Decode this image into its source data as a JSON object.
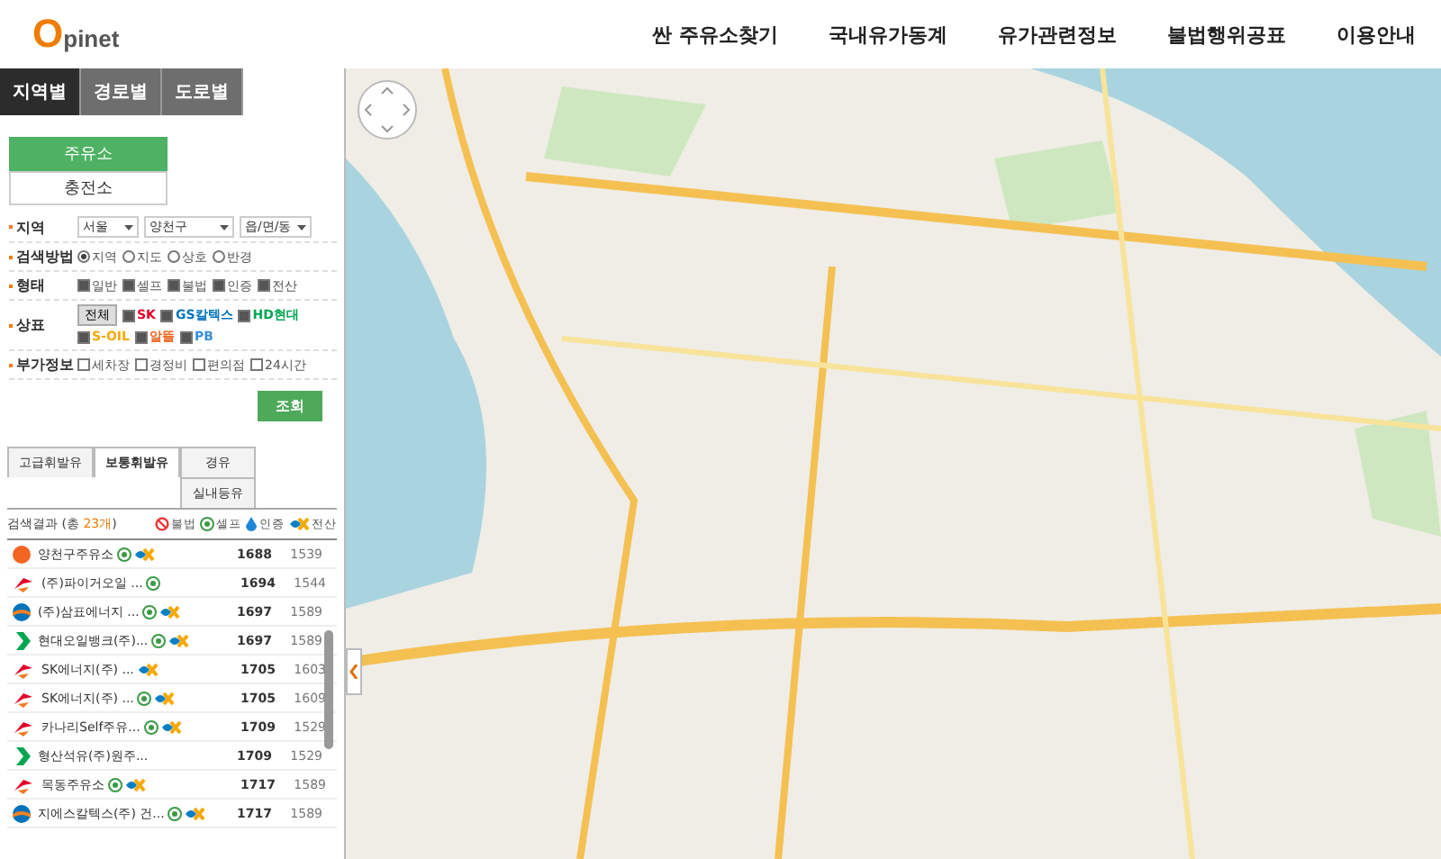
{
  "header": {
    "logo_initial": "O",
    "logo_rest": "pinet",
    "nav": [
      "싼 주유소찾기",
      "국내유가동계",
      "유가관련정보",
      "불법행위공표",
      "이용안내"
    ]
  },
  "search_tabs": [
    {
      "label": "지역별",
      "selected": true
    },
    {
      "label": "경로별",
      "selected": false
    },
    {
      "label": "도로별",
      "selected": false
    }
  ],
  "station_types": [
    {
      "label": "주유소",
      "selected": true
    },
    {
      "label": "충전소",
      "selected": false
    }
  ],
  "form": {
    "region": {
      "label": "지역",
      "selects": [
        "서울",
        "양천구",
        "읍/면/동"
      ]
    },
    "method": {
      "label": "검색방법",
      "options": [
        {
          "label": "지역",
          "selected": true
        },
        {
          "label": "지도",
          "selected": false
        },
        {
          "label": "상호",
          "selected": false
        },
        {
          "label": "반경",
          "selected": false
        }
      ]
    },
    "type": {
      "label": "형태",
      "options": [
        {
          "label": "일반",
          "checked": true
        },
        {
          "label": "셀프",
          "checked": true
        },
        {
          "label": "불법",
          "checked": true
        },
        {
          "label": "인증",
          "checked": true
        },
        {
          "label": "전산",
          "checked": true
        }
      ]
    },
    "brand": {
      "label": "상표",
      "all_button": "전체",
      "options": [
        {
          "label": "SK",
          "kind": "sk",
          "checked": true
        },
        {
          "label": "GS칼텍스",
          "kind": "gs",
          "checked": true
        },
        {
          "label": "HD현대",
          "kind": "hd",
          "checked": true
        },
        {
          "label": "S-OIL",
          "kind": "soil",
          "checked": true
        },
        {
          "label": "알뜰",
          "kind": "altteul",
          "checked": true
        },
        {
          "label": "PB",
          "kind": "pb",
          "checked": true
        }
      ]
    },
    "extra": {
      "label": "부가정보",
      "options": [
        {
          "label": "세차장",
          "checked": false
        },
        {
          "label": "경정비",
          "checked": false
        },
        {
          "label": "편의점",
          "checked": false
        },
        {
          "label": "24시간",
          "checked": false
        }
      ]
    },
    "submit": "조회"
  },
  "fuel_tabs": [
    {
      "label": "고급휘발유",
      "selected": false
    },
    {
      "label": "보통휘발유",
      "selected": true
    },
    {
      "label": "경유",
      "selected": false
    },
    {
      "label": "실내등유",
      "selected": false
    }
  ],
  "results": {
    "label": "검색결과 (총 ",
    "count": "23개",
    "close": ")",
    "legend": [
      {
        "kind": "illegal",
        "label": "불법"
      },
      {
        "kind": "self",
        "label": "셀프"
      },
      {
        "kind": "cert",
        "label": "인증"
      },
      {
        "kind": "pos",
        "label": "전산"
      }
    ]
  },
  "stations": [
    {
      "kind": "altteul",
      "name": "양천구주유소",
      "self": true,
      "pos": true,
      "price": "1688",
      "price_2": "1539"
    },
    {
      "kind": "sk",
      "name": "(주)파이거오일 ...",
      "self": true,
      "pos": false,
      "price": "1694",
      "price_2": "1544"
    },
    {
      "kind": "gs",
      "name": "(주)삼표에너지 ...",
      "self": true,
      "pos": true,
      "price": "1697",
      "price_2": "1589"
    },
    {
      "kind": "hd",
      "name": "현대오일뱅크(주)...",
      "self": true,
      "pos": true,
      "price": "1697",
      "price_2": "1589"
    },
    {
      "kind": "sk",
      "name": "SK에너지(주) ...",
      "self": false,
      "pos": true,
      "price": "1705",
      "price_2": "1603"
    },
    {
      "kind": "sk",
      "name": "SK에너지(주) ...",
      "self": true,
      "pos": true,
      "price": "1705",
      "price_2": "1609"
    },
    {
      "kind": "sk",
      "name": "카나리Self주유...",
      "self": true,
      "pos": true,
      "price": "1709",
      "price_2": "1529"
    },
    {
      "kind": "hd",
      "name": "형산석유(주)원주...",
      "self": false,
      "pos": false,
      "price": "1709",
      "price_2": "1529"
    },
    {
      "kind": "sk",
      "name": "목동주유소",
      "self": true,
      "pos": true,
      "price": "1717",
      "price_2": "1589"
    },
    {
      "kind": "gs",
      "name": "지에스칼텍스(주) 건...",
      "self": true,
      "pos": true,
      "price": "1717",
      "price_2": "1589"
    }
  ]
}
